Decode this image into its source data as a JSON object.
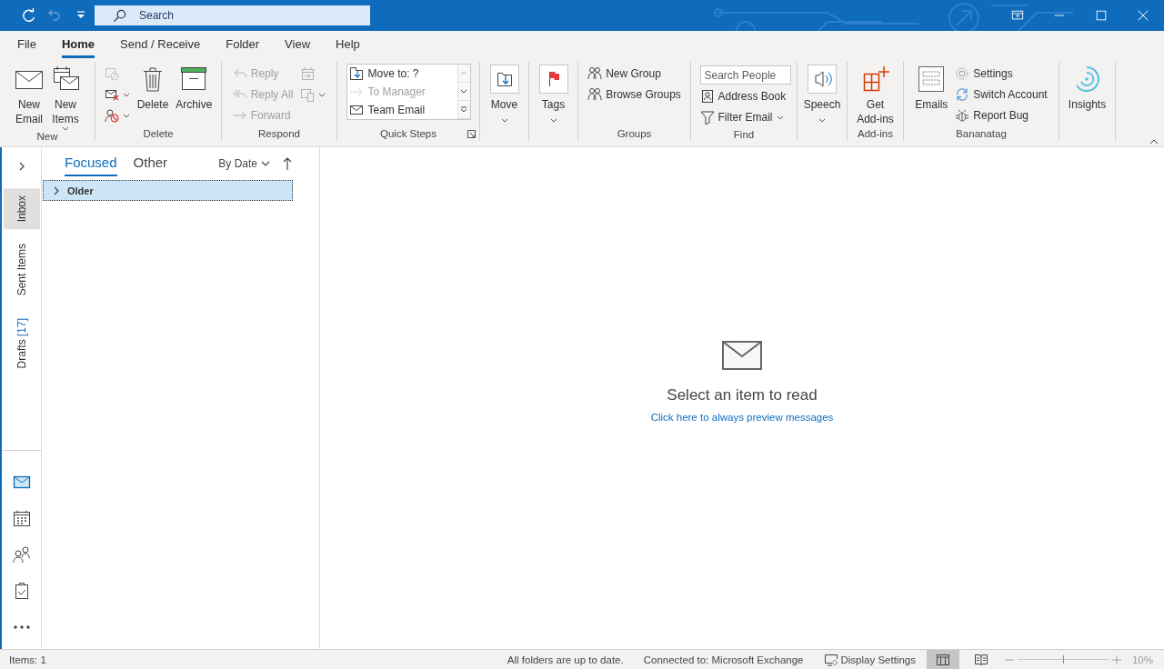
{
  "quick_access": [
    {
      "kind": "sync",
      "disabled": false
    },
    {
      "kind": "undo",
      "disabled": true
    },
    {
      "kind": "customize",
      "disabled": false
    }
  ],
  "search": {
    "placeholder": "Search"
  },
  "menu_tabs": [
    {
      "label": "File",
      "selected": false
    },
    {
      "label": "Home",
      "selected": true
    },
    {
      "label": "Send / Receive",
      "selected": false
    },
    {
      "label": "Folder",
      "selected": false
    },
    {
      "label": "View",
      "selected": false
    },
    {
      "label": "Help",
      "selected": false
    }
  ],
  "ribbon": {
    "groups": [
      {
        "label": "New",
        "items": [
          {
            "kind": "large",
            "lines": [
              "New",
              "Email"
            ],
            "disabled": false
          },
          {
            "kind": "large",
            "lines": [
              "New",
              "Items"
            ],
            "dropdown": true,
            "disabled": false
          }
        ]
      },
      {
        "label": "Delete",
        "items": [
          {
            "kind": "column",
            "items": [
              {
                "kind": "small",
                "disabled": true
              },
              {
                "kind": "small",
                "dropdown": true,
                "disabled": false
              },
              {
                "kind": "small",
                "dropdown": true,
                "disabled": false
              }
            ]
          },
          {
            "kind": "large",
            "lines": [
              "Delete"
            ],
            "disabled": false
          },
          {
            "kind": "large",
            "lines": [
              "Archive"
            ],
            "disabled": false
          }
        ]
      },
      {
        "label": "Respond",
        "items": [
          {
            "kind": "column",
            "items": [
              {
                "kind": "small",
                "label": "Reply",
                "disabled": true
              },
              {
                "kind": "small",
                "label": "Reply All",
                "disabled": true
              },
              {
                "kind": "small",
                "label": "Forward",
                "disabled": true
              }
            ]
          },
          {
            "kind": "column",
            "items": [
              {
                "kind": "small",
                "disabled": true
              },
              {
                "kind": "small",
                "dropdown": true,
                "disabled": true
              }
            ]
          }
        ]
      },
      {
        "label": "Quick Steps",
        "launcher": true,
        "items": [
          {
            "kind": "gallery",
            "items": [
              {
                "label": "Move to: ?",
                "disabled": false
              },
              {
                "label": "To Manager",
                "disabled": true
              },
              {
                "label": "Team Email",
                "disabled": false
              }
            ]
          }
        ]
      },
      {
        "items": [
          {
            "kind": "large",
            "lines": [
              "Move"
            ],
            "dropdown": true,
            "disabled": false
          }
        ]
      },
      {
        "items": [
          {
            "kind": "large",
            "lines": [
              "Tags"
            ],
            "dropdown": true,
            "disabled": false
          }
        ]
      },
      {
        "label": "Groups",
        "items": [
          {
            "kind": "column",
            "items": [
              {
                "kind": "small",
                "label": "New Group",
                "disabled": false
              },
              {
                "kind": "small",
                "label": "Browse Groups",
                "disabled": false
              }
            ]
          }
        ]
      },
      {
        "label": "Find",
        "items": [
          {
            "kind": "column",
            "items": [
              {
                "kind": "search",
                "placeholder": "Search People"
              },
              {
                "kind": "small",
                "label": "Address Book",
                "disabled": false
              },
              {
                "kind": "small",
                "label": "Filter Email",
                "dropdown": true,
                "disabled": false
              }
            ]
          }
        ]
      },
      {
        "items": [
          {
            "kind": "large",
            "lines": [
              "Speech"
            ],
            "dropdown": true,
            "disabled": false
          }
        ]
      },
      {
        "label": "Add-ins",
        "items": [
          {
            "kind": "large",
            "lines": [
              "Get",
              "Add-ins"
            ],
            "disabled": false
          }
        ]
      },
      {
        "label": "Bananatag",
        "items": [
          {
            "kind": "large",
            "lines": [
              "Emails"
            ],
            "disabled": false
          },
          {
            "kind": "column",
            "items": [
              {
                "kind": "small",
                "label": "Settings",
                "disabled": false
              },
              {
                "kind": "small",
                "label": "Switch Account",
                "disabled": false
              },
              {
                "kind": "small",
                "label": "Report Bug",
                "disabled": false
              }
            ]
          }
        ]
      },
      {
        "items": [
          {
            "kind": "large",
            "lines": [
              "Insights"
            ],
            "disabled": false
          }
        ]
      }
    ]
  },
  "folders": [
    {
      "label": "Inbox",
      "selected": true
    },
    {
      "label": "Sent Items",
      "selected": false
    },
    {
      "label": "Drafts",
      "count": "[17]",
      "selected": false
    }
  ],
  "modules": [
    {
      "kind": "mail",
      "selected": true
    },
    {
      "kind": "calendar",
      "selected": false
    },
    {
      "kind": "people",
      "selected": false
    },
    {
      "kind": "tasks",
      "selected": false
    },
    {
      "kind": "more",
      "selected": false
    }
  ],
  "inbox_tabs": [
    {
      "label": "Focused",
      "selected": true
    },
    {
      "label": "Other",
      "selected": false
    }
  ],
  "sort": {
    "label": "By Date"
  },
  "message_groups": [
    {
      "label": "Older",
      "expanded": false,
      "selected": true
    }
  ],
  "reading_pane": {
    "message": "Select an item to read",
    "link": "Click here to always preview messages"
  },
  "status_bar": {
    "items": "Items: 1",
    "sync": "All folders are up to date.",
    "connection": "Connected to: Microsoft Exchange",
    "display_settings": "Display Settings",
    "views": [
      {
        "kind": "normal",
        "selected": true
      },
      {
        "kind": "reading",
        "selected": false
      }
    ],
    "zoom": {
      "level": 0.5,
      "reading": "10%"
    }
  }
}
